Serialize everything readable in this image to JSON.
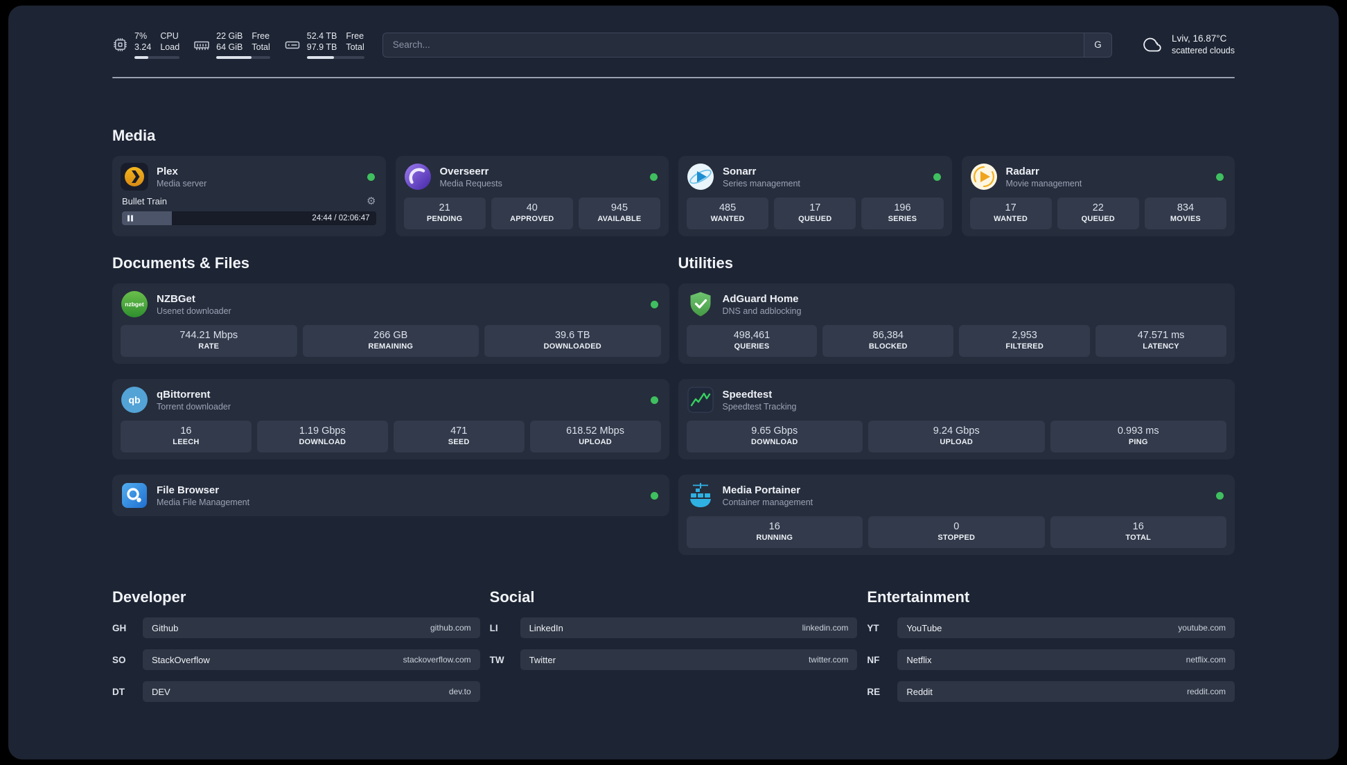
{
  "colors": {
    "bg-page": "#000000",
    "bg-window": "#1d2433",
    "bg-card": "#262d3c",
    "bg-tile": "#323a4b",
    "bg-bar": "#2e3544",
    "bg-track": "#171c28",
    "bg-input": "#262d3c",
    "border-input": "#3e4659",
    "divider": "#99a1b0",
    "status-green": "#3fbf5f",
    "progress-fill": "#dde2ea",
    "player-fill": "#4b5468"
  },
  "topbar": {
    "cpu": {
      "value1": "7%",
      "value2": "3.24",
      "label1": "CPU",
      "label2": "Load",
      "progress": 30
    },
    "ram": {
      "value1": "22 GiB",
      "value2": "64 GiB",
      "label1": "Free",
      "label2": "Total",
      "progress": 66
    },
    "disk": {
      "value1": "52.4 TB",
      "value2": "97.9 TB",
      "label1": "Free",
      "label2": "Total",
      "progress": 47
    },
    "search": {
      "placeholder": "Search...",
      "hotkey": "G"
    },
    "weather": {
      "location": "Lviv, 16.87°C",
      "condition": "scattered clouds"
    }
  },
  "sections": {
    "media": "Media",
    "documents": "Documents & Files",
    "utilities": "Utilities",
    "developer": "Developer",
    "social": "Social",
    "entertainment": "Entertainment"
  },
  "apps": {
    "plex": {
      "name": "Plex",
      "description": "Media server",
      "now_playing": {
        "title": "Bullet Train",
        "time": "24:44 / 02:06:47",
        "progress": 19.6
      }
    },
    "overseerr": {
      "name": "Overseerr",
      "description": "Media Requests",
      "stats": [
        {
          "value": "21",
          "label": "PENDING"
        },
        {
          "value": "40",
          "label": "APPROVED"
        },
        {
          "value": "945",
          "label": "AVAILABLE"
        }
      ]
    },
    "sonarr": {
      "name": "Sonarr",
      "description": "Series management",
      "stats": [
        {
          "value": "485",
          "label": "WANTED"
        },
        {
          "value": "17",
          "label": "QUEUED"
        },
        {
          "value": "196",
          "label": "SERIES"
        }
      ]
    },
    "radarr": {
      "name": "Radarr",
      "description": "Movie management",
      "stats": [
        {
          "value": "17",
          "label": "WANTED"
        },
        {
          "value": "22",
          "label": "QUEUED"
        },
        {
          "value": "834",
          "label": "MOVIES"
        }
      ]
    },
    "nzbget": {
      "name": "NZBGet",
      "description": "Usenet downloader",
      "stats": [
        {
          "value": "744.21 Mbps",
          "label": "RATE"
        },
        {
          "value": "266 GB",
          "label": "REMAINING"
        },
        {
          "value": "39.6 TB",
          "label": "DOWNLOADED"
        }
      ]
    },
    "qbittorrent": {
      "name": "qBittorrent",
      "description": "Torrent downloader",
      "stats": [
        {
          "value": "16",
          "label": "LEECH"
        },
        {
          "value": "1.19 Gbps",
          "label": "DOWNLOAD"
        },
        {
          "value": "471",
          "label": "SEED"
        },
        {
          "value": "618.52 Mbps",
          "label": "UPLOAD"
        }
      ]
    },
    "filebrowser": {
      "name": "File Browser",
      "description": "Media File Management"
    },
    "adguard": {
      "name": "AdGuard Home",
      "description": "DNS and adblocking",
      "stats": [
        {
          "value": "498,461",
          "label": "QUERIES"
        },
        {
          "value": "86,384",
          "label": "BLOCKED"
        },
        {
          "value": "2,953",
          "label": "FILTERED"
        },
        {
          "value": "47.571 ms",
          "label": "LATENCY"
        }
      ]
    },
    "speedtest": {
      "name": "Speedtest",
      "description": "Speedtest Tracking",
      "stats": [
        {
          "value": "9.65 Gbps",
          "label": "DOWNLOAD"
        },
        {
          "value": "9.24 Gbps",
          "label": "UPLOAD"
        },
        {
          "value": "0.993 ms",
          "label": "PING"
        }
      ]
    },
    "portainer": {
      "name": "Media Portainer",
      "description": "Container management",
      "stats": [
        {
          "value": "16",
          "label": "RUNNING"
        },
        {
          "value": "0",
          "label": "STOPPED"
        },
        {
          "value": "16",
          "label": "TOTAL"
        }
      ]
    }
  },
  "bookmarks": {
    "developer": [
      {
        "code": "GH",
        "name": "Github",
        "url": "github.com"
      },
      {
        "code": "SO",
        "name": "StackOverflow",
        "url": "stackoverflow.com"
      },
      {
        "code": "DT",
        "name": "DEV",
        "url": "dev.to"
      }
    ],
    "social": [
      {
        "code": "LI",
        "name": "LinkedIn",
        "url": "linkedin.com"
      },
      {
        "code": "TW",
        "name": "Twitter",
        "url": "twitter.com"
      }
    ],
    "entertainment": [
      {
        "code": "YT",
        "name": "YouTube",
        "url": "youtube.com"
      },
      {
        "code": "NF",
        "name": "Netflix",
        "url": "netflix.com"
      },
      {
        "code": "RE",
        "name": "Reddit",
        "url": "reddit.com"
      }
    ]
  }
}
